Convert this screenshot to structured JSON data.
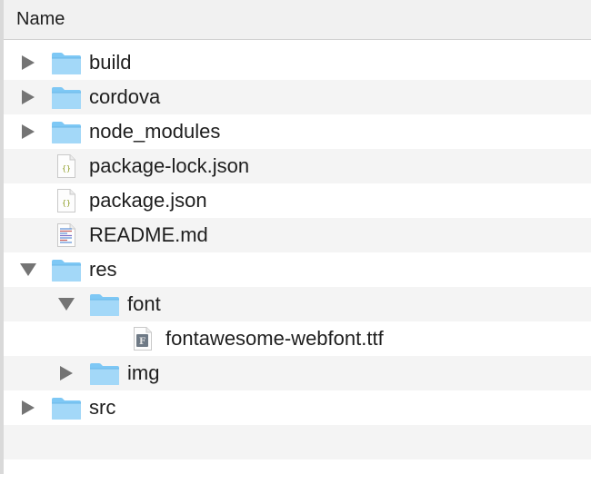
{
  "header": {
    "name_label": "Name"
  },
  "colors": {
    "folder": "#7ec8f5",
    "folder_tab": "#a3d8f8",
    "alt_row": "#f4f4f4"
  },
  "rows": [
    {
      "label": "build",
      "icon": "folder-icon",
      "depth": 0,
      "disclosure": "collapsed"
    },
    {
      "label": "cordova",
      "icon": "folder-icon",
      "depth": 0,
      "disclosure": "collapsed"
    },
    {
      "label": "node_modules",
      "icon": "folder-icon",
      "depth": 0,
      "disclosure": "collapsed"
    },
    {
      "label": "package-lock.json",
      "icon": "json-file-icon",
      "depth": 0,
      "disclosure": "none"
    },
    {
      "label": "package.json",
      "icon": "json-file-icon",
      "depth": 0,
      "disclosure": "none"
    },
    {
      "label": "README.md",
      "icon": "text-file-icon",
      "depth": 0,
      "disclosure": "none"
    },
    {
      "label": "res",
      "icon": "folder-icon",
      "depth": 0,
      "disclosure": "expanded"
    },
    {
      "label": "font",
      "icon": "folder-icon",
      "depth": 1,
      "disclosure": "expanded"
    },
    {
      "label": "fontawesome-webfont.ttf",
      "icon": "font-file-icon",
      "depth": 2,
      "disclosure": "none"
    },
    {
      "label": "img",
      "icon": "folder-icon",
      "depth": 1,
      "disclosure": "collapsed"
    },
    {
      "label": "src",
      "icon": "folder-icon",
      "depth": 0,
      "disclosure": "collapsed"
    }
  ]
}
